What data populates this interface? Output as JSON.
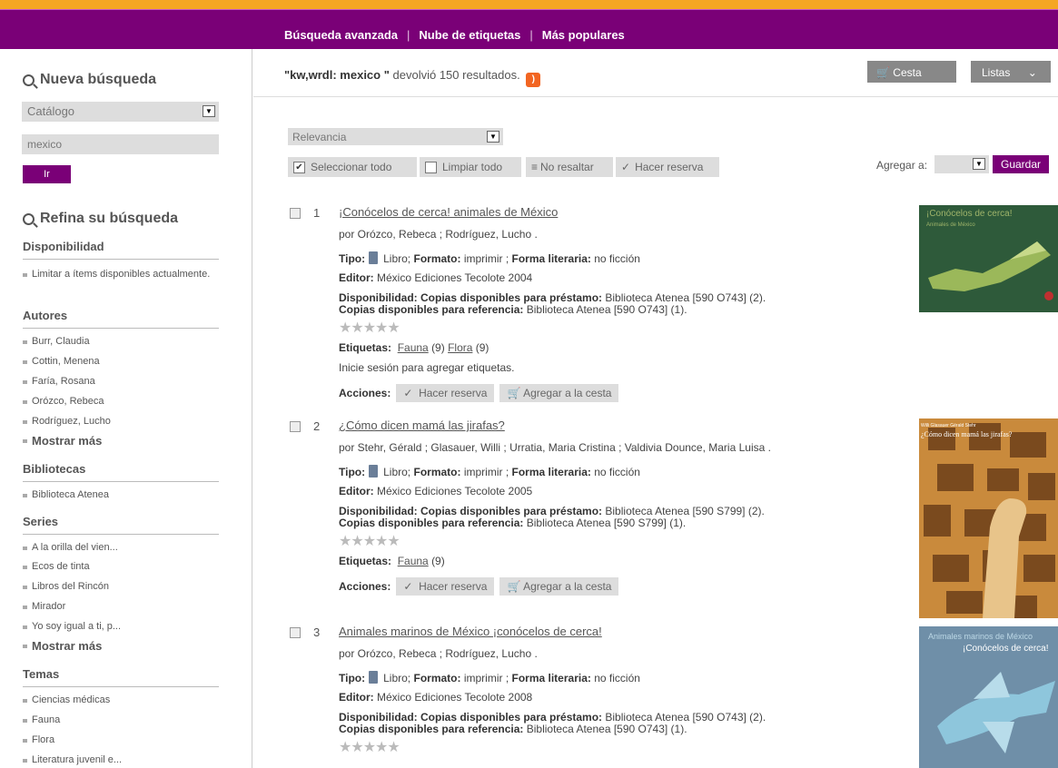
{
  "nav": {
    "links": [
      "Búsqueda avanzada",
      "Nube de etiquetas",
      "Más populares"
    ],
    "sep": "|"
  },
  "sidebar": {
    "new_search_title": "Nueva búsqueda",
    "catalog_select": "Catálogo",
    "query": "mexico",
    "go": "Ir",
    "refine_title": "Refina su búsqueda",
    "facets": [
      {
        "heading": "Disponibilidad",
        "items": [
          "Limitar a ítems disponibles actualmente."
        ]
      },
      {
        "heading": "Autores",
        "items": [
          "Burr, Claudia",
          "Cottin, Menena",
          "Faría, Rosana",
          "Orózco, Rebeca",
          "Rodríguez, Lucho"
        ],
        "more": "Mostrar más"
      },
      {
        "heading": "Bibliotecas",
        "items": [
          "Biblioteca Atenea"
        ]
      },
      {
        "heading": "Series",
        "items": [
          "A la orilla del vien...",
          "Ecos de tinta",
          "Libros del Rincón",
          "Mirador",
          "Yo soy igual a ti, p..."
        ],
        "more": "Mostrar más"
      },
      {
        "heading": "Temas",
        "items": [
          "Ciencias médicas",
          "Fauna",
          "Flora",
          "Literatura juvenil e..."
        ]
      }
    ]
  },
  "results": {
    "query_label": "\"kw,wrdl: mexico \"",
    "count_text": "devolvió 150 resultados.",
    "cesta": "Cesta",
    "listas": "Listas",
    "sort": "Relevancia",
    "tools": {
      "select_all": "Seleccionar todo",
      "clear_all": "Limpiar todo",
      "no_highlight": "No resaltar",
      "hold": "Hacer reserva"
    },
    "add_to": "Agregar a:",
    "save": "Guardar",
    "records": [
      {
        "num": "1",
        "title": "¡Conócelos de cerca! animales de México",
        "authors": "por Orózco, Rebeca ; Rodríguez, Lucho .",
        "tipo_label": "Tipo:",
        "tipo": "Libro;",
        "formato_label": "Formato:",
        "formato": "imprimir ;",
        "forma_label": "Forma literaria:",
        "forma": "no ficción",
        "editor_label": "Editor:",
        "editor": "México Ediciones Tecolote 2004",
        "disp_label": "Disponibilidad: Copias disponibles para préstamo:",
        "disp": "Biblioteca Atenea [590 O743] (2).",
        "ref_label": "Copias disponibles para referencia:",
        "ref": "Biblioteca Atenea [590 O743] (1).",
        "tags_label": "Etiquetas:",
        "tags": [
          {
            "name": "Fauna",
            "count": "(9)"
          },
          {
            "name": "Flora",
            "count": "(9)"
          }
        ],
        "login_note": "Inicie sesión para agregar etiquetas.",
        "actions_label": "Acciones:",
        "hold": "Hacer reserva",
        "cart": "Agregar a la cesta",
        "cover_title": "¡Conócelos de cerca!",
        "cover_sub": "Animales de México"
      },
      {
        "num": "2",
        "title": "¿Cómo dicen mamá las jirafas?",
        "authors": "por Stehr, Gérald ; Glasauer, Willi ; Urratia, Maria Cristina ; Valdivia Dounce, Maria Luisa .",
        "tipo_label": "Tipo:",
        "tipo": "Libro;",
        "formato_label": "Formato:",
        "formato": "imprimir ;",
        "forma_label": "Forma literaria:",
        "forma": "no ficción",
        "editor_label": "Editor:",
        "editor": "México Ediciones Tecolote 2005",
        "disp_label": "Disponibilidad: Copias disponibles para préstamo:",
        "disp": "Biblioteca Atenea [590 S799] (2).",
        "ref_label": "Copias disponibles para referencia:",
        "ref": "Biblioteca Atenea [590 S799] (1).",
        "tags_label": "Etiquetas:",
        "tags": [
          {
            "name": "Fauna",
            "count": "(9)"
          }
        ],
        "actions_label": "Acciones:",
        "hold": "Hacer reserva",
        "cart": "Agregar a la cesta",
        "cover_title": "¿Cómo dicen mamá las jirafas?",
        "cover_sub": "Willi Glasauer Gérald Stehr"
      },
      {
        "num": "3",
        "title": "Animales marinos de México ¡conócelos de cerca!",
        "authors": "por Orózco, Rebeca ; Rodríguez, Lucho .",
        "tipo_label": "Tipo:",
        "tipo": "Libro;",
        "formato_label": "Formato:",
        "formato": "imprimir ;",
        "forma_label": "Forma literaria:",
        "forma": "no ficción",
        "editor_label": "Editor:",
        "editor": "México Ediciones Tecolote 2008",
        "disp_label": "Disponibilidad: Copias disponibles para préstamo:",
        "disp": "Biblioteca Atenea [590 O743] (2).",
        "ref_label": "Copias disponibles para referencia:",
        "ref": "Biblioteca Atenea [590 O743] (1).",
        "cover_title": "Animales marinos de México",
        "cover_sub": "¡Conócelos de cerca!"
      }
    ]
  },
  "colors": {
    "brand": "#7a0077",
    "topline": "#f5a623",
    "rss": "#f26522"
  }
}
